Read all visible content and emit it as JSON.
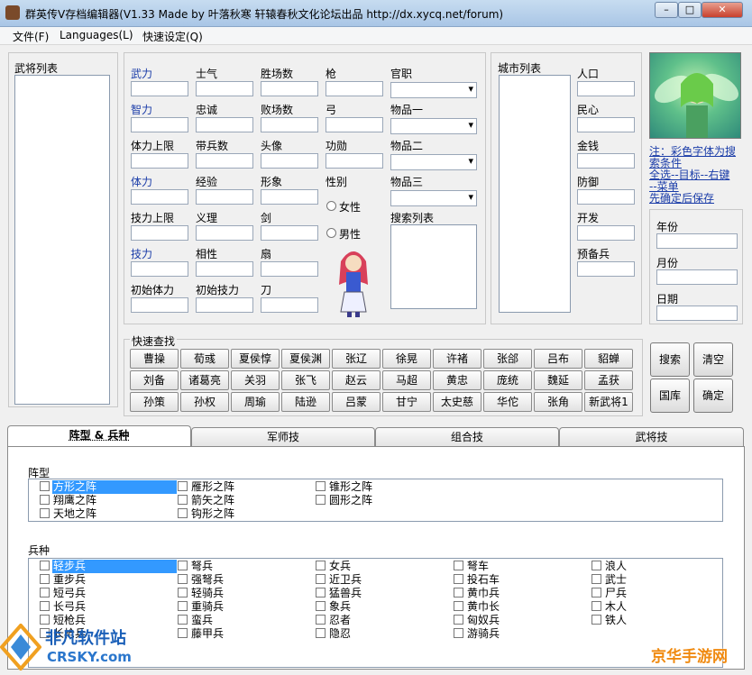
{
  "window": {
    "title": "群英传V存档编辑器(V1.33 Made by 叶落秋寒 轩辕春秋文化论坛出品 http://dx.xycq.net/forum)",
    "min": "–",
    "max": "□",
    "close": "✕"
  },
  "menu": [
    "文件(F)",
    "Languages(L)",
    "快速设定(Q)"
  ],
  "general_list_label": "武将列表",
  "stats": {
    "c1": [
      "武力",
      "智力",
      "体力上限",
      "体力",
      "技力上限",
      "技力",
      "初始体力"
    ],
    "c2": [
      "士气",
      "忠诚",
      "带兵数",
      "经验",
      "义理",
      "相性",
      "初始技力"
    ],
    "c3": [
      "胜场数",
      "败场数",
      "头像",
      "形象",
      "剑",
      "扇",
      "刀"
    ],
    "c4": [
      "枪",
      "弓",
      "功勋",
      "性别"
    ]
  },
  "gender": [
    "女性",
    "男性"
  ],
  "items": {
    "rank": "官职",
    "item1": "物品一",
    "item2": "物品二",
    "item3": "物品三",
    "search_list": "搜索列表"
  },
  "city": {
    "list_label": "城市列表",
    "fields": [
      "人口",
      "民心",
      "金钱",
      "防御",
      "开发",
      "预备兵"
    ]
  },
  "note": [
    "注：彩色字体为搜",
    "索条件",
    "全选--目标--右键",
    "--菜单",
    "先确定后保存"
  ],
  "date": [
    "年份",
    "月份",
    "日期"
  ],
  "quick_search": {
    "label": "快速查找",
    "buttons": [
      [
        "曹操",
        "荀彧",
        "夏侯惇",
        "夏侯渊",
        "张辽",
        "徐晃",
        "许褚",
        "张郃",
        "吕布",
        "貂蝉"
      ],
      [
        "刘备",
        "诸葛亮",
        "关羽",
        "张飞",
        "赵云",
        "马超",
        "黄忠",
        "庞统",
        "魏延",
        "孟获"
      ],
      [
        "孙策",
        "孙权",
        "周瑜",
        "陆逊",
        "吕蒙",
        "甘宁",
        "太史慈",
        "华佗",
        "张角",
        "新武将1"
      ]
    ]
  },
  "actions": [
    "搜索",
    "清空",
    "国库",
    "确定"
  ],
  "tabs": [
    "阵型 & 兵种",
    "军师技",
    "组合技",
    "武将技"
  ],
  "formation": {
    "label": "阵型",
    "items": [
      [
        "方形之阵",
        "翔鹰之阵",
        "天地之阵"
      ],
      [
        "雁形之阵",
        "箭矢之阵",
        "钩形之阵"
      ],
      [
        "锥形之阵",
        "圆形之阵"
      ]
    ]
  },
  "troops": {
    "label": "兵种",
    "items": [
      [
        "轻步兵",
        "重步兵",
        "短弓兵",
        "长弓兵",
        "短枪兵",
        "长枪兵"
      ],
      [
        "弩兵",
        "强弩兵",
        "轻骑兵",
        "重骑兵",
        "蛮兵",
        "藤甲兵"
      ],
      [
        "女兵",
        "近卫兵",
        "猛兽兵",
        "象兵",
        "忍者",
        "隐忍"
      ],
      [
        "弩车",
        "投石车",
        "黄巾兵",
        "黄巾长",
        "匈奴兵",
        "游骑兵"
      ],
      [
        "浪人",
        "武士",
        "尸兵",
        "木人",
        "铁人"
      ]
    ]
  },
  "watermarks": {
    "left_cn": "非凡软件站",
    "left_en": "CRSKY.com",
    "right": "京华手游网"
  },
  "colors": {
    "accent": "#1a3ca8",
    "selection": "#3399ff"
  }
}
